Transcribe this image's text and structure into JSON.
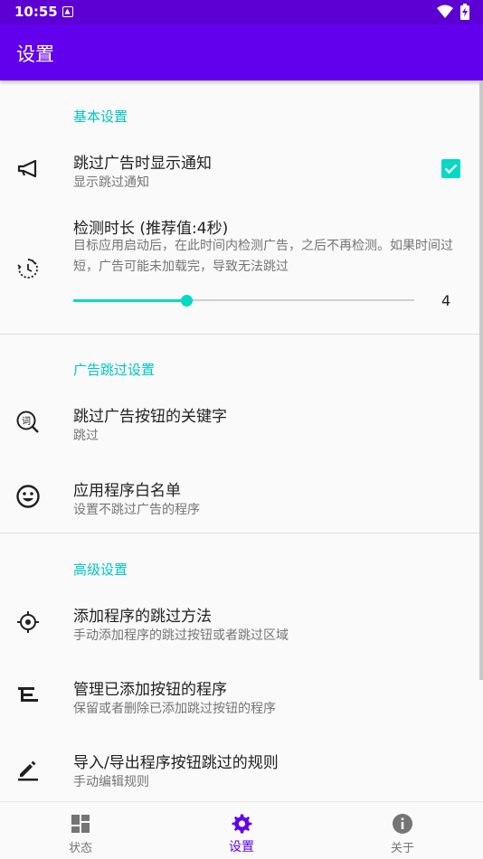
{
  "status_bar": {
    "time": "10:55"
  },
  "app_bar": {
    "title": "设置"
  },
  "sections": {
    "basic": {
      "header": "基本设置",
      "notify": {
        "title": "跳过广告时显示通知",
        "subtitle": "显示跳过通知",
        "checked": true
      },
      "duration": {
        "title": "检测时长 (推荐值:4秒)",
        "description": "目标应用启动后，在此时间内检测广告，之后不再检测。如果时间过短，广告可能未加载完，导致无法跳过",
        "slider_value": "4"
      }
    },
    "skip": {
      "header": "广告跳过设置",
      "keywords": {
        "title": "跳过广告按钮的关键字",
        "subtitle": "跳过"
      },
      "whitelist": {
        "title": "应用程序白名单",
        "subtitle": "设置不跳过广告的程序"
      }
    },
    "advanced": {
      "header": "高级设置",
      "add_method": {
        "title": "添加程序的跳过方法",
        "subtitle": "手动添加程序的跳过按钮或者跳过区域"
      },
      "manage": {
        "title": "管理已添加按钮的程序",
        "subtitle": "保留或者删除已添加跳过按钮的程序"
      },
      "import_export": {
        "title": "导入/导出程序按钮跳过的规则",
        "subtitle": "手动编辑规则"
      }
    }
  },
  "bottom_nav": {
    "items": [
      {
        "label": "状态",
        "icon": "dashboard-icon"
      },
      {
        "label": "设置",
        "icon": "settings-icon",
        "active": true
      },
      {
        "label": "关于",
        "icon": "info-icon"
      }
    ]
  },
  "colors": {
    "primary": "#6200ee",
    "status_bar": "#5c00d4",
    "accent": "#03dac5",
    "section_header": "#03c4c4"
  }
}
